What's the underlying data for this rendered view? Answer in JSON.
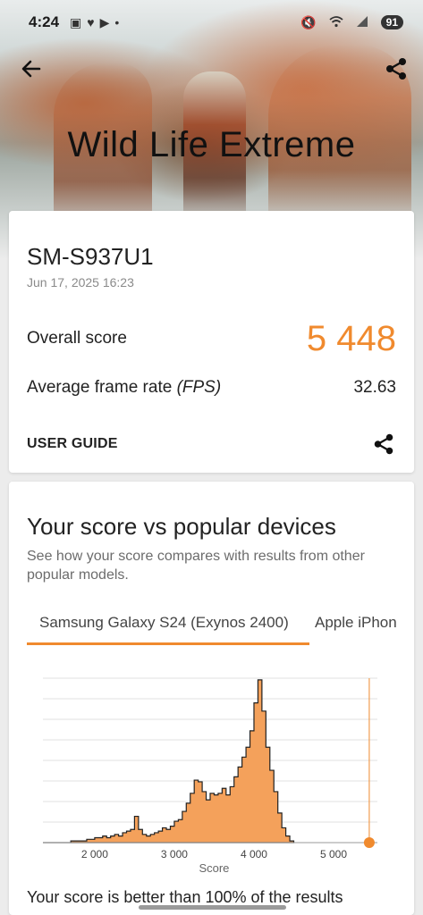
{
  "status_bar": {
    "time": "4:24",
    "battery": "91"
  },
  "header": {
    "title": "Wild Life Extreme"
  },
  "result": {
    "device": "SM-S937U1",
    "date": "Jun 17, 2025 16:23",
    "overall_label": "Overall score",
    "overall_score": "5 448",
    "fps_label": "Average frame rate",
    "fps_unit": "(FPS)",
    "fps_value": "32.63",
    "user_guide": "USER GUIDE"
  },
  "compare": {
    "title": "Your score vs popular devices",
    "subtitle": "See how your score compares with results from other popular models.",
    "tabs": [
      {
        "label": "Samsung Galaxy S24 (Exynos 2400)",
        "active": true
      },
      {
        "label": "Apple iPhon",
        "active": false
      }
    ],
    "bottom_text": "Your score is better than 100% of the results"
  },
  "colors": {
    "accent": "#f08a2e",
    "histogram_fill": "#f4a15b"
  },
  "chart_data": {
    "type": "area",
    "xlabel": "Score",
    "ylabel": "",
    "xlim": [
      1350,
      5550
    ],
    "ylim": [
      0,
      100
    ],
    "x_ticks": [
      {
        "value": 2000,
        "label": "2 000"
      },
      {
        "value": 3000,
        "label": "3 000"
      },
      {
        "value": 4000,
        "label": "4 000"
      },
      {
        "value": 5000,
        "label": "5 000"
      }
    ],
    "grid": true,
    "series": [
      {
        "x": [
          1350,
          1500,
          1700,
          1800,
          1900,
          2000,
          2050,
          2100,
          2150,
          2200,
          2250,
          2300,
          2350,
          2400,
          2450,
          2500,
          2550,
          2600,
          2650,
          2700,
          2750,
          2800,
          2850,
          2900,
          2950,
          3000,
          3050,
          3100,
          3150,
          3200,
          3250,
          3300,
          3350,
          3400,
          3450,
          3500,
          3550,
          3600,
          3650,
          3700,
          3750,
          3800,
          3850,
          3900,
          3950,
          4000,
          4050,
          4100,
          4150,
          4200,
          4250,
          4300,
          4350,
          4400,
          4450,
          4500
        ],
        "values": [
          0,
          0,
          1,
          1,
          2,
          3,
          3,
          4,
          3,
          4,
          5,
          4,
          6,
          7,
          8,
          16,
          8,
          5,
          4,
          5,
          6,
          7,
          9,
          8,
          10,
          13,
          14,
          19,
          24,
          30,
          38,
          37,
          31,
          26,
          30,
          29,
          30,
          33,
          29,
          34,
          40,
          46,
          52,
          58,
          68,
          85,
          99,
          80,
          58,
          44,
          31,
          18,
          9,
          4,
          1,
          0
        ]
      }
    ],
    "marker": {
      "x": 5448,
      "label": "Your score"
    }
  }
}
